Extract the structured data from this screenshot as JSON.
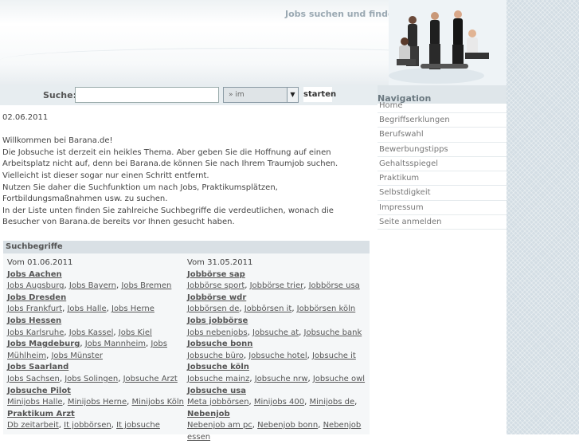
{
  "header": {
    "tagline": "Jobs suchen und finden"
  },
  "search": {
    "label": "Suche:",
    "input_value": "",
    "select_value": "» im",
    "button_label": "starten"
  },
  "content": {
    "date": "02.06.2011",
    "paragraphs": [
      "Willkommen bei Barana.de!",
      "Die Jobsuche ist derzeit ein heikles Thema. Aber geben Sie die Hoffnung auf einen Arbeitsplatz nicht auf, denn bei Barana.de können Sie nach Ihrem Traumjob suchen. Vielleicht ist dieser sogar nur einen Schritt entfernt.",
      "Nutzen Sie daher die Suchfunktion um nach Jobs, Praktikumsplätzen, Fortbildungsmaßnahmen usw. zu suchen.",
      "In der Liste unten finden Sie zahlreiche Suchbegriffe die verdeutlichen, wonach die Besucher von Barana.de bereits vor Ihnen gesucht haben."
    ]
  },
  "keywords": {
    "title": "Suchbegriffe",
    "col1": {
      "heading": "Vom 01.06.2011",
      "lines": [
        [
          {
            "t": "Jobs Aachen",
            "b": true
          }
        ],
        [
          {
            "t": "Jobs Augsburg"
          },
          {
            "t": "Jobs Bayern"
          },
          {
            "t": "Jobs Bremen"
          }
        ],
        [
          {
            "t": "Jobs Dresden",
            "b": true
          }
        ],
        [
          {
            "t": "Jobs Frankfurt"
          },
          {
            "t": "Jobs Halle"
          },
          {
            "t": "Jobs Herne"
          }
        ],
        [
          {
            "t": "Jobs Hessen",
            "b": true
          }
        ],
        [
          {
            "t": "Jobs Karlsruhe"
          },
          {
            "t": "Jobs Kassel"
          },
          {
            "t": "Jobs Kiel"
          }
        ],
        [
          {
            "t": "Jobs Magdeburg",
            "b": true
          },
          {
            "t": "Jobs Mannheim"
          },
          {
            "t": "Jobs Mühlheim"
          },
          {
            "t": "Jobs Münster"
          }
        ],
        [
          {
            "t": "Jobs Saarland",
            "b": true
          }
        ],
        [
          {
            "t": "Jobs Sachsen"
          },
          {
            "t": "Jobs Solingen"
          },
          {
            "t": "Jobsuche Arzt"
          }
        ],
        [
          {
            "t": "Jobsuche Pilot",
            "b": true
          }
        ],
        [
          {
            "t": "Minijobs Halle"
          },
          {
            "t": "Minijobs Herne"
          },
          {
            "t": "Minijobs Köln"
          }
        ],
        [
          {
            "t": "Praktikum Arzt",
            "b": true
          }
        ],
        [
          {
            "t": "Db zeitarbeit"
          },
          {
            "t": "It jobbörsen"
          },
          {
            "t": "It jobsuche"
          }
        ]
      ]
    },
    "col2": {
      "heading": "Vom 31.05.2011",
      "lines": [
        [
          {
            "t": "Jobbörse sap",
            "b": true
          }
        ],
        [
          {
            "t": "Jobbörse sport"
          },
          {
            "t": "Jobbörse trier"
          },
          {
            "t": "Jobbörse usa"
          }
        ],
        [
          {
            "t": "Jobbörse wdr",
            "b": true
          }
        ],
        [
          {
            "t": "Jobbörsen de"
          },
          {
            "t": "Jobbörsen it"
          },
          {
            "t": "Jobbörsen köln"
          }
        ],
        [
          {
            "t": "Jobs jobbörse",
            "b": true
          }
        ],
        [
          {
            "t": "Jobs nebenjobs"
          },
          {
            "t": "Jobsuche at"
          },
          {
            "t": "Jobsuche bank"
          }
        ],
        [
          {
            "t": "Jobsuche bonn",
            "b": true
          }
        ],
        [
          {
            "t": "Jobsuche büro"
          },
          {
            "t": "Jobsuche hotel"
          },
          {
            "t": "Jobsuche it"
          }
        ],
        [
          {
            "t": "Jobsuche köln",
            "b": true
          }
        ],
        [
          {
            "t": "Jobsuche mainz"
          },
          {
            "t": "Jobsuche nrw"
          },
          {
            "t": "Jobsuche owl"
          }
        ],
        [
          {
            "t": "Jobsuche usa",
            "b": true
          }
        ],
        [
          {
            "t": "Meta jobbörsen"
          },
          {
            "t": "Minijobs 400"
          },
          {
            "t": "Minijobs de"
          },
          {
            "t": "Nebenjob",
            "b": true
          }
        ],
        [
          {
            "t": "Nebenjob am pc"
          },
          {
            "t": "Nebenjob bonn"
          },
          {
            "t": "Nebenjob essen"
          }
        ]
      ]
    }
  },
  "nav": {
    "heading": "Navigation",
    "items": [
      "Home",
      "Begriffserklungen",
      "Berufswahl",
      "Bewerbungstipps",
      "Gehaltsspiegel",
      "Praktikum",
      "Selbstdigkeit",
      "Impressum",
      "Seite anmelden"
    ]
  }
}
